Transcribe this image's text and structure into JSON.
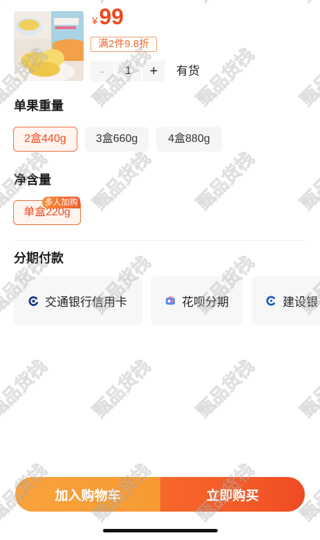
{
  "product": {
    "currency": "¥",
    "price": "99",
    "promo_tag": "满2件9.8折",
    "minus_symbol": "-",
    "quantity": "1",
    "plus_symbol": "+",
    "stock_status": "有货"
  },
  "sections": [
    {
      "title": "单果重量",
      "options": [
        {
          "label": "2盒440g",
          "selected": true
        },
        {
          "label": "3盒660g",
          "selected": false
        },
        {
          "label": "4盒880g",
          "selected": false
        }
      ]
    },
    {
      "title": "净含量",
      "options": [
        {
          "label": "单盒220g",
          "selected": true,
          "badge": "多人加购"
        }
      ]
    }
  ],
  "installments": {
    "title": "分期付款",
    "options": [
      {
        "icon": "bocom-icon",
        "label": "交通银行信用卡"
      },
      {
        "icon": "huabei-icon",
        "label": "花呗分期"
      },
      {
        "icon": "ccb-icon",
        "label": "建设银"
      }
    ]
  },
  "actions": {
    "add_to_cart": "加入购物车",
    "buy_now": "立即购买"
  },
  "watermark": {
    "text": "甄品货栈"
  },
  "colors": {
    "accent": "#f2481f",
    "promo": "#f26a2c",
    "selected_border": "#f06b3a",
    "selected_bg": "#fff4ee",
    "add_to_cart": "#f79a33",
    "buy_now": "#f35a27"
  }
}
